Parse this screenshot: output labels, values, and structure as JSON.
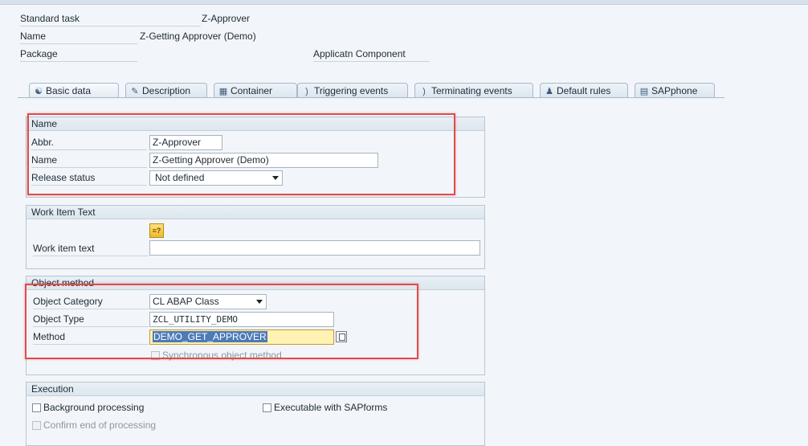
{
  "header": {
    "standard_task_label": "Standard task",
    "standard_task_value": "Z-Approver",
    "name_label": "Name",
    "name_value": "Z-Getting Approver (Demo)",
    "package_label": "Package",
    "app_component_label": "Applicatn Component"
  },
  "tabs": [
    {
      "label": "Basic data",
      "icon": "basic-data-icon",
      "active": true
    },
    {
      "label": "Description",
      "icon": "description-icon"
    },
    {
      "label": "Container",
      "icon": "container-icon"
    },
    {
      "label": "Triggering events",
      "icon": "triggering-events-icon"
    },
    {
      "label": "Terminating events",
      "icon": "terminating-events-icon"
    },
    {
      "label": "Default rules",
      "icon": "default-rules-icon"
    },
    {
      "label": "SAPphone",
      "icon": "sapphone-icon"
    }
  ],
  "name_group": {
    "title": "Name",
    "abbr_label": "Abbr.",
    "abbr_value": "Z-Approver",
    "name_label": "Name",
    "name_value": "Z-Getting Approver (Demo)",
    "release_label": "Release status",
    "release_value": "Not defined"
  },
  "work_item_group": {
    "title": "Work Item Text",
    "text_label": "Work item text",
    "text_value": ""
  },
  "object_method_group": {
    "title": "Object method",
    "category_label": "Object Category",
    "category_value": "CL ABAP Class",
    "type_label": "Object Type",
    "type_value": "ZCL_UTILITY_DEMO",
    "method_label": "Method",
    "method_value": "DEMO_GET_APPROVER",
    "sync_label": "Synchronous object method"
  },
  "execution_group": {
    "title": "Execution",
    "background_label": "Background processing",
    "sapforms_label": "Executable with SAPforms",
    "confirm_label": "Confirm end of processing"
  },
  "colors": {
    "highlight_box": "#e34a4a",
    "selection": "#4d7ab8",
    "field_highlight": "#fff2b3"
  }
}
